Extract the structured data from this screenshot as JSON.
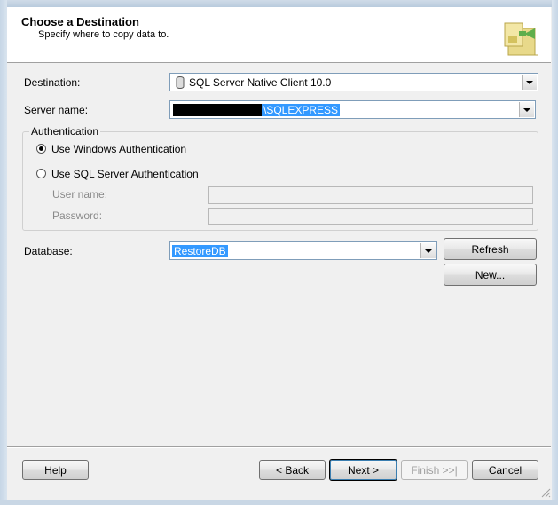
{
  "header": {
    "title": "Choose a Destination",
    "subtitle": "Specify where to copy data to."
  },
  "form": {
    "destination_label": "Destination:",
    "destination_value": "SQL Server Native Client 10.0",
    "server_label": "Server name:",
    "server_value": "\\SQLEXPRESS",
    "auth_legend": "Authentication",
    "windows_auth_label": "Use Windows Authentication",
    "sql_auth_label": "Use SQL Server Authentication",
    "username_label": "User name:",
    "password_label": "Password:",
    "database_label": "Database:",
    "database_value": "RestoreDB",
    "refresh_label": "Refresh",
    "new_label": "New..."
  },
  "footer": {
    "help_label": "Help",
    "back_label": "< Back",
    "next_label": "Next >",
    "finish_label": "Finish >>|",
    "cancel_label": "Cancel"
  },
  "colors": {
    "selection": "#3399ff",
    "window_bg": "#f0f0f0"
  },
  "state": {
    "selected_auth": "windows"
  }
}
